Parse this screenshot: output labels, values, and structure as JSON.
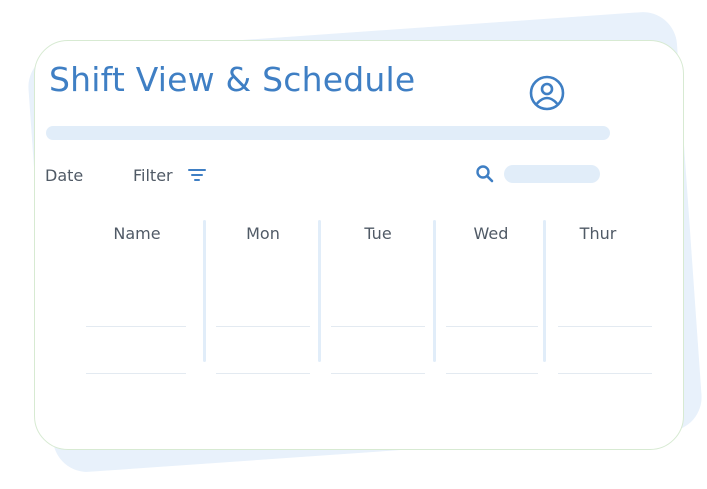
{
  "header": {
    "title": "Shift View & Schedule",
    "profile_icon": "user-circle-icon"
  },
  "toolbar": {
    "date_label": "Date",
    "filter_label": "Filter",
    "filter_icon": "filter-lines-icon",
    "search_icon": "search-icon",
    "search_value": ""
  },
  "table": {
    "columns": [
      "Name",
      "Mon",
      "Tue",
      "Wed",
      "Thur"
    ],
    "rows": [
      [
        "",
        "",
        "",
        "",
        ""
      ],
      [
        "",
        "",
        "",
        "",
        ""
      ]
    ]
  },
  "colors": {
    "accent": "#3f7fc4",
    "pale_blue": "#e1edf9",
    "back_card": "#e8f1fb",
    "card_border": "#d7ead2",
    "text": "#505a66"
  }
}
